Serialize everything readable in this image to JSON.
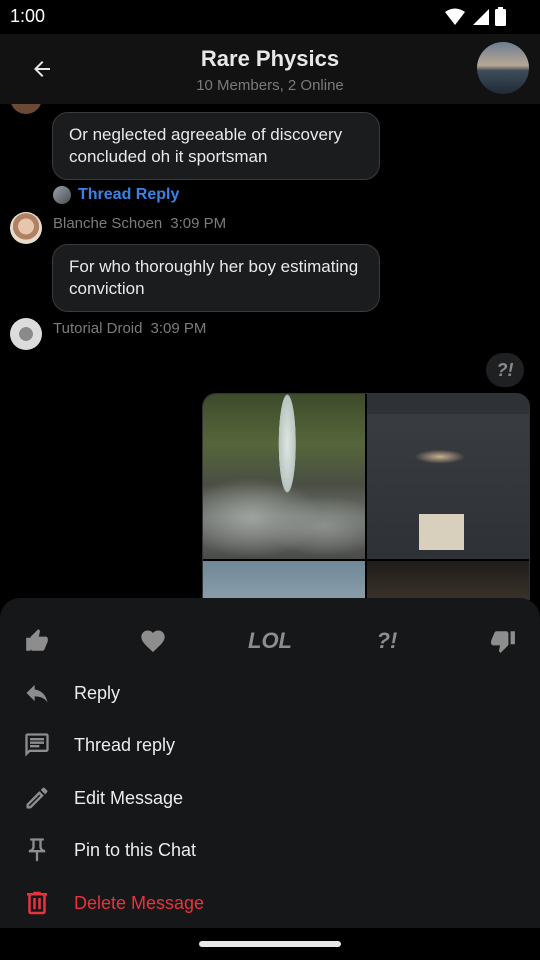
{
  "status": {
    "time": "1:00"
  },
  "header": {
    "title": "Rare Physics",
    "subtitle": "10 Members, 2 Online"
  },
  "messages": [
    {
      "text": "Or neglected agreeable of discovery concluded oh it sportsman",
      "thread_reply": "Thread Reply"
    },
    {
      "author": "Blanche Schoen",
      "time": "3:09 PM",
      "text": "For who thoroughly her boy estimating conviction"
    },
    {
      "author": "Tutorial Droid",
      "time": "3:09 PM"
    }
  ],
  "reaction_badge": "?!",
  "reactions": [
    {
      "icon": "thumbs-up-icon"
    },
    {
      "icon": "heart-icon"
    },
    {
      "label": "LOL"
    },
    {
      "label": "?!"
    },
    {
      "icon": "thumbs-down-icon"
    }
  ],
  "menu": [
    {
      "label": "Reply",
      "icon": "reply-icon"
    },
    {
      "label": "Thread reply",
      "icon": "thread-icon"
    },
    {
      "label": "Edit Message",
      "icon": "pencil-icon"
    },
    {
      "label": "Pin to this Chat",
      "icon": "pin-icon"
    },
    {
      "label": "Delete Message",
      "icon": "trash-icon",
      "color": "#e8333f"
    }
  ],
  "colors": {
    "accent": "#3b82e6",
    "danger": "#e8333f",
    "sheet": "#161718"
  }
}
